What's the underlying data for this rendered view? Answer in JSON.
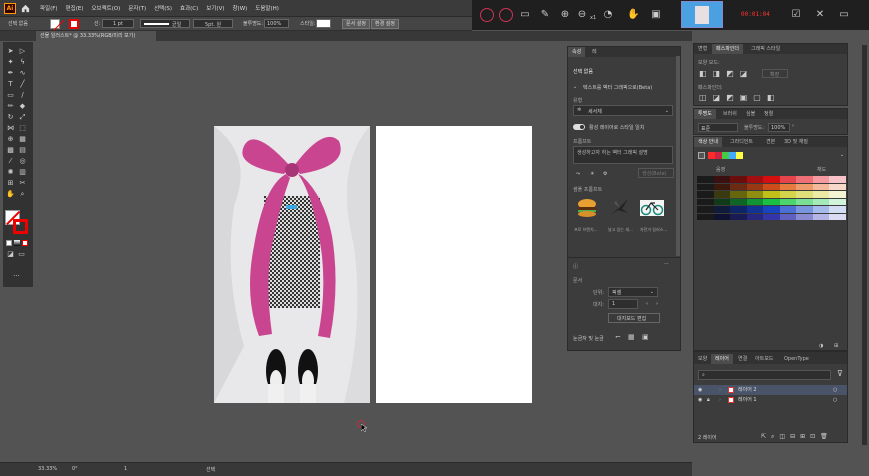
{
  "app": {
    "logo": "Ai"
  },
  "menu": {
    "items": [
      "파일(F)",
      "편집(E)",
      "오브젝트(O)",
      "문자(T)",
      "선택(S)",
      "효과(C)",
      "보기(V)",
      "창(W)",
      "도움말(H)"
    ]
  },
  "recorder": {
    "timer": "00:01:04",
    "x1": "x1"
  },
  "control_bar": {
    "selection_label": "선택 없음",
    "stroke_weight": "1 pt",
    "uniform": "균일",
    "brush": "5pt. 원",
    "opacity_label": "불투명도:",
    "opacity_value": "100%",
    "style_label": "스타일:",
    "doc_setup": "문서 설정",
    "prefs": "환경 설정"
  },
  "document_tab": {
    "title": "선물 일러스트* @ 33.33%(RGB/미리 보기)"
  },
  "status": {
    "zoom": "33.33%",
    "rotation": "0°",
    "page": "1",
    "mode": "선택"
  },
  "properties_panel": {
    "tabs": [
      "속성",
      "레"
    ],
    "heading": "선택 없음",
    "text_to_vector": "텍스트를 벡터 그래픽으로(Beta)",
    "type_label": "유형",
    "type_value": "세서체",
    "toggle_label": "활성 레이어로 스타일 일치",
    "prompt_label": "프롬프트",
    "prompt_placeholder": "생성하고자 하는 벡터 그래픽 설명",
    "generate_btn": "생성(Beta)",
    "samples_label": "샘플 프롬프트",
    "samples": [
      {
        "label": "프로 브렌치..."
      },
      {
        "label": "날고 있는 새..."
      },
      {
        "label": "자전거 일러스..."
      }
    ],
    "doc_label": "문서",
    "unit_label": "단위:",
    "unit_value": "픽셀",
    "artboard_label": "대지:",
    "artboard_value": "1",
    "edit_artboard_btn": "대지보드 편집",
    "grid_label": "눈금자 및 눈금"
  },
  "pathfinder_panel": {
    "tabs": [
      "변형",
      "패스파인더",
      "그래픽 스타일"
    ],
    "shape_mode": "모양 모드:",
    "expand_btn": "확장",
    "pathfinders": "패스파인더:"
  },
  "transparency_panel": {
    "tabs": [
      "투명도",
      "브러쉬",
      "심볼",
      "정렬"
    ],
    "blend_mode": "표준",
    "opacity_label": "불투명도:",
    "opacity_value": "100%"
  },
  "swatches_panel": {
    "tabs": [
      "색상 안내",
      "그라디언트",
      "견본",
      "3D 및 재질"
    ],
    "left_label": "음영",
    "right_label": "채도",
    "grid": [
      [
        "#1a1a1a",
        "#3a1010",
        "#6a0d0d",
        "#a30f10",
        "#d40f10",
        "#e5454a",
        "#ec7076",
        "#f49aa0",
        "#f8c3c8"
      ],
      [
        "#1a1a1a",
        "#3b1a0d",
        "#6b2b12",
        "#993913",
        "#cc4d1a",
        "#e77a3e",
        "#ee9b6b",
        "#f4b99a",
        "#f8d8c9"
      ],
      [
        "#1a1a1a",
        "#3a3a10",
        "#66660d",
        "#8e8e10",
        "#c0c019",
        "#d5d54c",
        "#e0e07a",
        "#ebeba5",
        "#f4f4d2"
      ],
      [
        "#1a1a1a",
        "#103a18",
        "#0d6625",
        "#109434",
        "#19c044",
        "#4cd56f",
        "#7ae095",
        "#a5ebba",
        "#d2f4dd"
      ],
      [
        "#1a1a1a",
        "#101a3a",
        "#0d2566",
        "#103394",
        "#1944c0",
        "#4c6fd5",
        "#7a95e0",
        "#a5baeb",
        "#d2ddf4"
      ],
      [
        "#1a1a1a",
        "#101030",
        "#1a1a55",
        "#272780",
        "#3535aa",
        "#6060c0",
        "#8a8ad3",
        "#b5b5e5",
        "#dadaf2"
      ]
    ],
    "strip": [
      "#ff2a2a",
      "#cc2244",
      "#44cc44",
      "#44aaff",
      "#ffff44"
    ]
  },
  "layers_panel": {
    "tabs": [
      "모양",
      "레이어",
      "연결",
      "아트보드",
      "OpenType"
    ],
    "search_placeholder": "",
    "layers": [
      {
        "name": "레이어 2"
      },
      {
        "name": "레이어 1"
      }
    ],
    "count": "2 레이어"
  }
}
